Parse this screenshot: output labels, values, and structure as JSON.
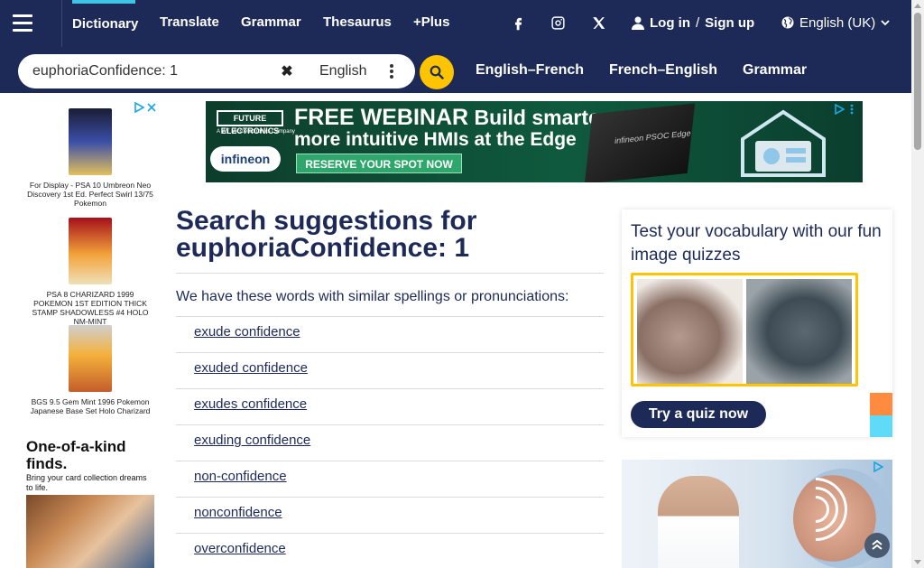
{
  "nav": {
    "links": [
      {
        "label": "Dictionary",
        "active": true
      },
      {
        "label": "Translate"
      },
      {
        "label": "Grammar"
      },
      {
        "label": "Thesaurus"
      },
      {
        "label": "+Plus"
      }
    ],
    "social": [
      "facebook-icon",
      "instagram-icon",
      "x-icon"
    ],
    "login_label": "Log in",
    "login_sep": "/",
    "signup_label": "Sign up",
    "language_label": "English (UK)"
  },
  "search": {
    "value": "euphoriaConfidence: 1",
    "dictionary_label": "English",
    "quick_links": [
      "English–French",
      "French–English",
      "Grammar"
    ]
  },
  "left_ad": {
    "cards": [
      {
        "text": "For Display - PSA 10 Umbreon Neo Discovery 1st Ed. Perfect Swirl 13/75 Pokemon"
      },
      {
        "text": "PSA 8 CHARIZARD 1999 POKEMON 1ST EDITION THICK STAMP SHADOWLESS #4 HOLO NM-MINT"
      },
      {
        "text": "BGS 9.5 Gem Mint 1996 Pokemon Japanese Base Set Holo Charizard"
      }
    ],
    "promo_title": "One-of-a-kind finds.",
    "promo_sub": "Bring your card collection dreams to life."
  },
  "banner_ad": {
    "brand": "FUTURE ELECTRONICS",
    "brand_sub": "A WT Microelectronics Company",
    "partner": "infineon",
    "headline_big": "FREE WEBINAR",
    "headline_rest": " Build smarter,",
    "headline_line2": "more intuitive HMIs at the Edge",
    "cta": "RESERVE YOUR SPOT NOW",
    "chip_label": "infineon PSOC Edge"
  },
  "main": {
    "heading_prefix": "Search suggestions for",
    "heading_query": "euphoriaConfidence: 1",
    "intro": "We have these words with similar spellings or pronunciations:",
    "suggestions": [
      "exude confidence",
      "exuded confidence",
      "exudes confidence",
      "exuding confidence",
      "non-confidence",
      "nonconfidence",
      "overconfidence"
    ]
  },
  "quiz": {
    "title": "Test your vocabulary with our fun image quizzes",
    "button_label": "Try a quiz now"
  },
  "colors": {
    "navy": "#1d2a57",
    "yellow": "#fec400",
    "cyan": "#3ec4e6",
    "orange": "#fe8b3f"
  }
}
